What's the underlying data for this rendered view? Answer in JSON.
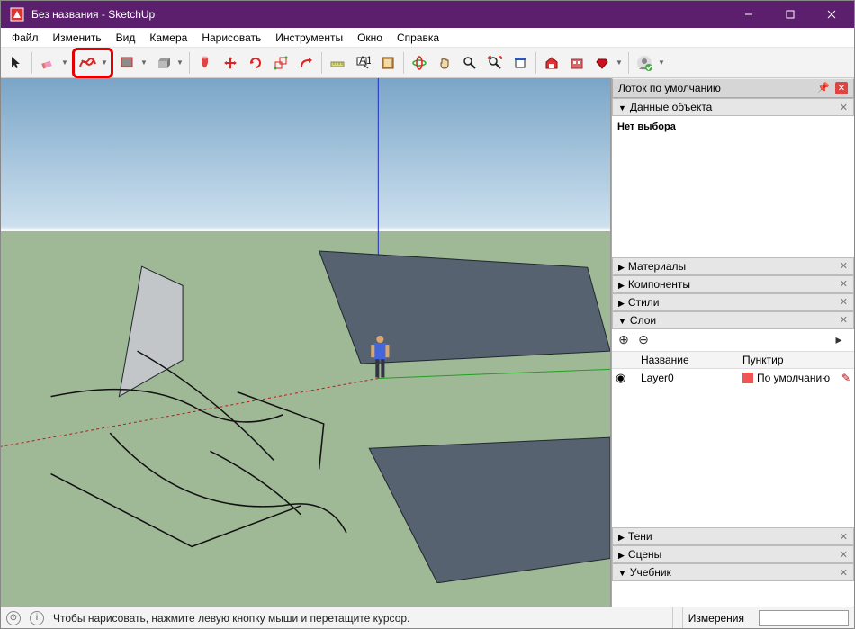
{
  "window": {
    "title": "Без названия - SketchUp"
  },
  "menu": {
    "items": [
      "Файл",
      "Изменить",
      "Вид",
      "Камера",
      "Нарисовать",
      "Инструменты",
      "Окно",
      "Справка"
    ]
  },
  "toolbar": {
    "items": [
      {
        "name": "select-tool",
        "icon": "cursor"
      },
      {
        "name": "eraser-tool",
        "icon": "eraser",
        "dropdown": true
      },
      {
        "name": "freehand-tool",
        "icon": "freehand",
        "dropdown": true,
        "highlight": true
      },
      {
        "name": "shapes-tool",
        "icon": "rect",
        "dropdown": true
      },
      {
        "name": "pushpull-tool",
        "icon": "pushpull",
        "dropdown": true
      },
      {
        "name": "paint-tool",
        "icon": "paint"
      },
      {
        "name": "move-tool",
        "icon": "move"
      },
      {
        "name": "rotate-tool",
        "icon": "rotate"
      },
      {
        "name": "scale-tool",
        "icon": "scale"
      },
      {
        "name": "offset-tool",
        "icon": "offset"
      },
      "sep",
      {
        "name": "tape-tool",
        "icon": "tape"
      },
      {
        "name": "text-tool",
        "icon": "text"
      },
      {
        "name": "section-tool",
        "icon": "section"
      },
      "sep",
      {
        "name": "orbit-tool",
        "icon": "orbit"
      },
      {
        "name": "pan-tool",
        "icon": "pan"
      },
      {
        "name": "zoom-tool",
        "icon": "zoom"
      },
      {
        "name": "zoom-extents-tool",
        "icon": "zoomext"
      },
      {
        "name": "zoom-window-tool",
        "icon": "zoomwin"
      },
      "sep",
      {
        "name": "warehouse-tool",
        "icon": "warehouse"
      },
      {
        "name": "extension-tool",
        "icon": "extension"
      },
      {
        "name": "ruby-tool",
        "icon": "ruby",
        "dropdown": true
      },
      "sep",
      {
        "name": "user-tool",
        "icon": "user",
        "dropdown": true
      }
    ]
  },
  "tray": {
    "title": "Лоток по умолчанию",
    "panels": {
      "entity_info": {
        "label": "Данные объекта",
        "open": true,
        "content": "Нет выбора"
      },
      "materials": {
        "label": "Материалы",
        "open": false
      },
      "components": {
        "label": "Компоненты",
        "open": false
      },
      "styles": {
        "label": "Стили",
        "open": false
      },
      "layers": {
        "label": "Слои",
        "open": true,
        "cols": {
          "name": "Название",
          "dash": "Пунктир"
        },
        "rows": [
          {
            "name": "Layer0",
            "dash": "По умолчанию"
          }
        ]
      },
      "shadows": {
        "label": "Тени",
        "open": false
      },
      "scenes": {
        "label": "Сцены",
        "open": false
      },
      "instructor": {
        "label": "Учебник",
        "open": true
      }
    }
  },
  "status": {
    "hint": "Чтобы нарисовать, нажмите левую кнопку мыши и перетащите курсор.",
    "measurements_label": "Измерения"
  }
}
